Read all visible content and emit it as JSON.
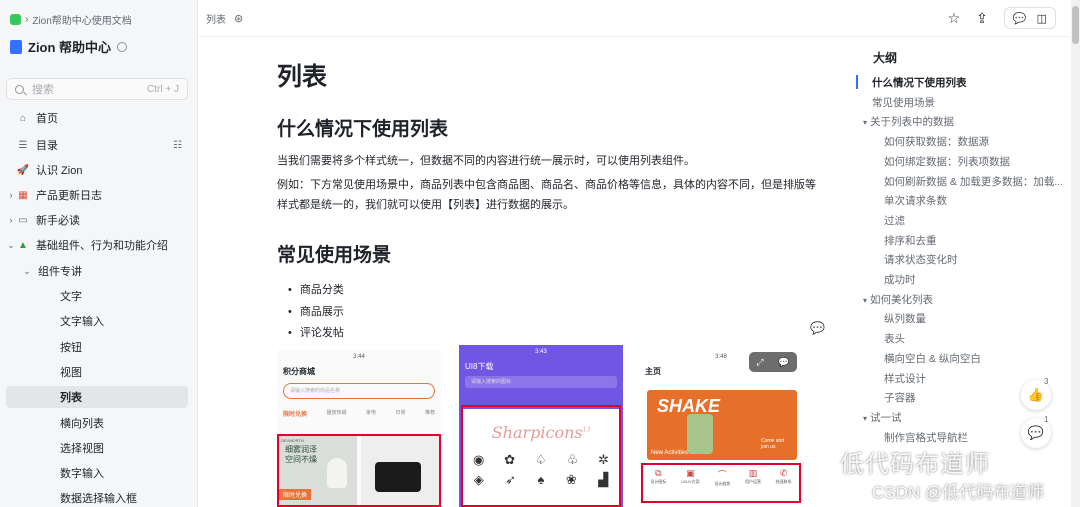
{
  "sidebar": {
    "breadcrumb": "Zion帮助中心使用文档",
    "title": "Zion 帮助中心",
    "search_placeholder": "搜索",
    "search_shortcut": "Ctrl + J",
    "items": [
      {
        "label": "首页"
      },
      {
        "label": "目录"
      },
      {
        "label": "认识 Zion"
      },
      {
        "label": "产品更新日志"
      },
      {
        "label": "新手必读"
      },
      {
        "label": "基础组件、行为和功能介绍"
      },
      {
        "label": "组件专讲"
      },
      {
        "label": "文字"
      },
      {
        "label": "文字输入"
      },
      {
        "label": "按钮"
      },
      {
        "label": "视图"
      },
      {
        "label": "列表"
      },
      {
        "label": "横向列表"
      },
      {
        "label": "选择视图"
      },
      {
        "label": "数字输入"
      },
      {
        "label": "数据选择输入框"
      }
    ]
  },
  "topbar": {
    "doc_title": "列表"
  },
  "main": {
    "title": "列表",
    "section1_heading": "什么情况下使用列表",
    "para1": "当我们需要将多个样式统一，但数据不同的内容进行统一展示时，可以使用列表组件。",
    "para2": "例如：下方常见使用场景中，商品列表中包含商品图、商品名、商品价格等信息，具体的内容不同，但是排版等样式都是统一的，我们就可以使用【列表】进行数据的展示。",
    "section2_heading": "常见使用场景",
    "bullets": [
      "商品分类",
      "商品展示",
      "评论发帖"
    ],
    "phones": [
      {
        "time": "3:44",
        "title": "积分商城",
        "search": "请输入搜索的商品名称",
        "tabs": [
          "限时兑换",
          "播放热销",
          "家电",
          "日常",
          "推荐"
        ],
        "promo1": "细雾润泽",
        "promo2": "空间不燥",
        "promo3": "限时兑换",
        "brand": "DEVMORTH"
      },
      {
        "time": "3:43",
        "title": "UI8下载",
        "search": "请输入搜索的图标",
        "logo": "Sharpicons",
        "logo_count": "13"
      },
      {
        "time": "3:48",
        "title": "主页",
        "banner": "SHAKE",
        "banner_sub": "New Activities",
        "banner_cta": "Come and join us",
        "icons": [
          "设计图标",
          "UI/UX方案",
          "设计趋势",
          "用户运营",
          "快速联系"
        ]
      }
    ]
  },
  "outline": {
    "title": "大纲",
    "items": [
      {
        "label": "什么情况下使用列表",
        "level": 0,
        "active": true
      },
      {
        "label": "常见使用场景",
        "level": 0
      },
      {
        "label": "关于列表中的数据",
        "level": 0,
        "caret": true
      },
      {
        "label": "如何获取数据：数据源",
        "level": 1
      },
      {
        "label": "如何绑定数据：列表项数据",
        "level": 1
      },
      {
        "label": "如何刷新数据 & 加载更多数据：加载...",
        "level": 1
      },
      {
        "label": "单次请求条数",
        "level": 1
      },
      {
        "label": "过滤",
        "level": 1
      },
      {
        "label": "排序和去重",
        "level": 1
      },
      {
        "label": "请求状态变化时",
        "level": 1
      },
      {
        "label": "成功时",
        "level": 1
      },
      {
        "label": "如何美化列表",
        "level": 0,
        "caret": true
      },
      {
        "label": "纵列数量",
        "level": 1
      },
      {
        "label": "表头",
        "level": 1
      },
      {
        "label": "横向空白 & 纵向空白",
        "level": 1
      },
      {
        "label": "样式设计",
        "level": 1
      },
      {
        "label": "子容器",
        "level": 1
      },
      {
        "label": "试一试",
        "level": 0,
        "caret": true
      },
      {
        "label": "制作宫格式导航栏",
        "level": 1
      }
    ]
  },
  "floats": {
    "like_count": "3",
    "comment_count": "1"
  },
  "watermark": {
    "line1": "低代码布道师",
    "line2": "CSDN @低代码布道师"
  }
}
